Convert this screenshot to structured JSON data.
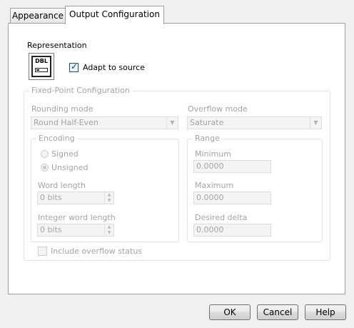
{
  "tabs": [
    {
      "label": "Appearance",
      "active": false
    },
    {
      "label": "Output Configuration",
      "active": true
    }
  ],
  "representation": {
    "label": "Representation",
    "icon_text": "DBL",
    "icon": "dbl-numeric-icon",
    "adapt_label": "Adapt to source",
    "adapt_checked": true
  },
  "fixed_point": {
    "title": "Fixed-Point Configuration",
    "rounding_label": "Rounding mode",
    "rounding_value": "Round Half-Even",
    "overflow_label": "Overflow mode",
    "overflow_value": "Saturate",
    "encoding": {
      "title": "Encoding",
      "signed_label": "Signed",
      "unsigned_label": "Unsigned",
      "selected": "Unsigned",
      "word_length_label": "Word length",
      "word_length_value": "0 bits",
      "integer_word_length_label": "Integer word length",
      "integer_word_length_value": "0 bits"
    },
    "range": {
      "title": "Range",
      "minimum_label": "Minimum",
      "minimum_value": "0.0000",
      "maximum_label": "Maximum",
      "maximum_value": "0.0000",
      "delta_label": "Desired delta",
      "delta_value": "0.0000"
    },
    "include_overflow_label": "Include overflow status",
    "include_overflow_checked": false
  },
  "buttons": {
    "ok": "OK",
    "cancel": "Cancel",
    "help": "Help"
  }
}
